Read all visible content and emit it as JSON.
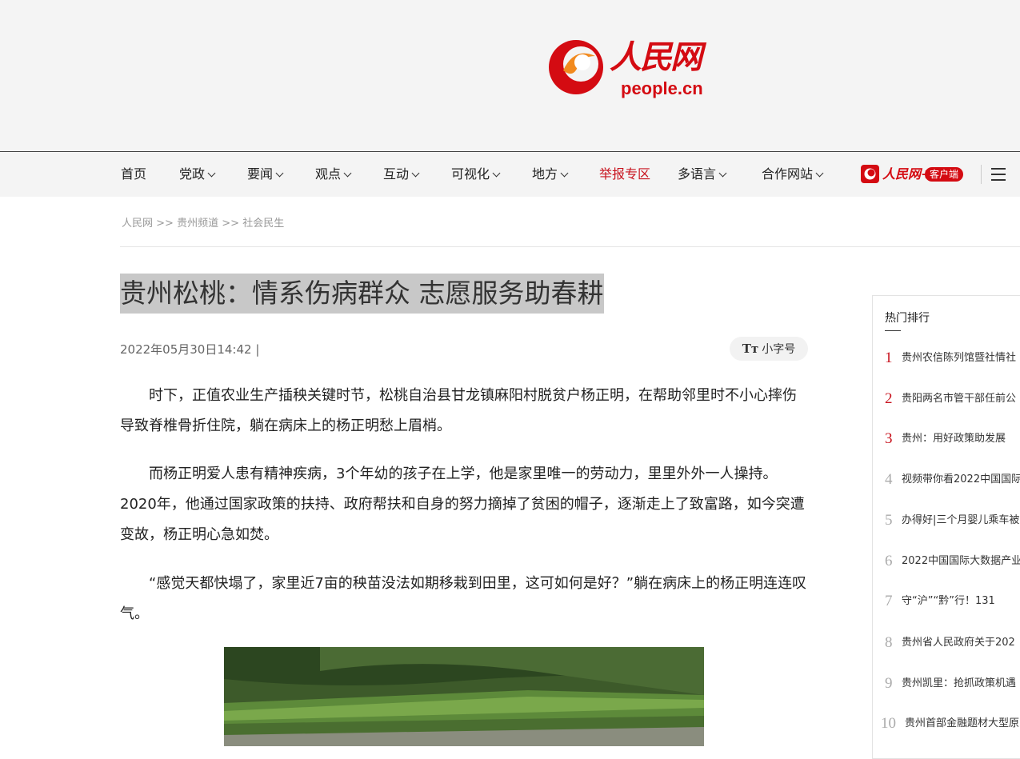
{
  "brand": {
    "name_cn": "人民网",
    "domain": "people.cn",
    "color": "#d40b12"
  },
  "nav": {
    "items": [
      {
        "label": "首页",
        "dropdown": false
      },
      {
        "label": "党政",
        "dropdown": true
      },
      {
        "label": "要闻",
        "dropdown": true
      },
      {
        "label": "观点",
        "dropdown": true
      },
      {
        "label": "互动",
        "dropdown": true
      },
      {
        "label": "可视化",
        "dropdown": true
      },
      {
        "label": "地方",
        "dropdown": true
      },
      {
        "label": "举报专区",
        "dropdown": false,
        "highlight": true
      },
      {
        "label": "多语言",
        "dropdown": true
      },
      {
        "label": "合作网站",
        "dropdown": true
      }
    ],
    "app_name": "人民网+",
    "app_badge": "客户端",
    "menu_icon": "hamburger-menu-icon"
  },
  "breadcrumb": [
    "人民网",
    ">>",
    "贵州频道",
    ">>",
    "社会民生"
  ],
  "article": {
    "title": "贵州松桃：情系伤病群众 志愿服务助春耕",
    "datetime": "2022年05月30日14:42 |",
    "font_toggle": "小字号",
    "font_toggle_icon": "Tт",
    "paragraphs": [
      "时下，正值农业生产插秧关键时节，松桃自治县甘龙镇麻阳村脱贫户杨正明，在帮助邻里时不小心摔伤导致脊椎骨折住院，躺在病床上的杨正明愁上眉梢。",
      "而杨正明爱人患有精神疾病，3个年幼的孩子在上学，他是家里唯一的劳动力，里里外外一人操持。2020年，他通过国家政策的扶持、政府帮扶和自身的努力摘掉了贫困的帽子，逐渐走上了致富路，如今突遭变故，杨正明心急如焚。",
      "“感觉天都快塌了，家里近7亩的秧苗没法如期移栽到田里，这可如何是好？”躺在病床上的杨正明连连叹气。"
    ]
  },
  "sidebar": {
    "title": "热门排行",
    "items": [
      {
        "rank": "1",
        "text": "贵州农信陈列馆暨社情社"
      },
      {
        "rank": "2",
        "text": "贵阳两名市管干部任前公"
      },
      {
        "rank": "3",
        "text": "贵州：用好政策助发展"
      },
      {
        "rank": "4",
        "text": "视频带你看2022中国国际"
      },
      {
        "rank": "5",
        "text": "办得好|三个月婴儿乘车被"
      },
      {
        "rank": "6",
        "text": "2022中国国际大数据产业"
      },
      {
        "rank": "7",
        "text": "守“沪”“黔”行！131"
      },
      {
        "rank": "8",
        "text": "贵州省人民政府关于202"
      },
      {
        "rank": "9",
        "text": "贵州凯里：抢抓政策机遇"
      },
      {
        "rank": "10",
        "text": "贵州首部金融题材大型原"
      }
    ]
  }
}
